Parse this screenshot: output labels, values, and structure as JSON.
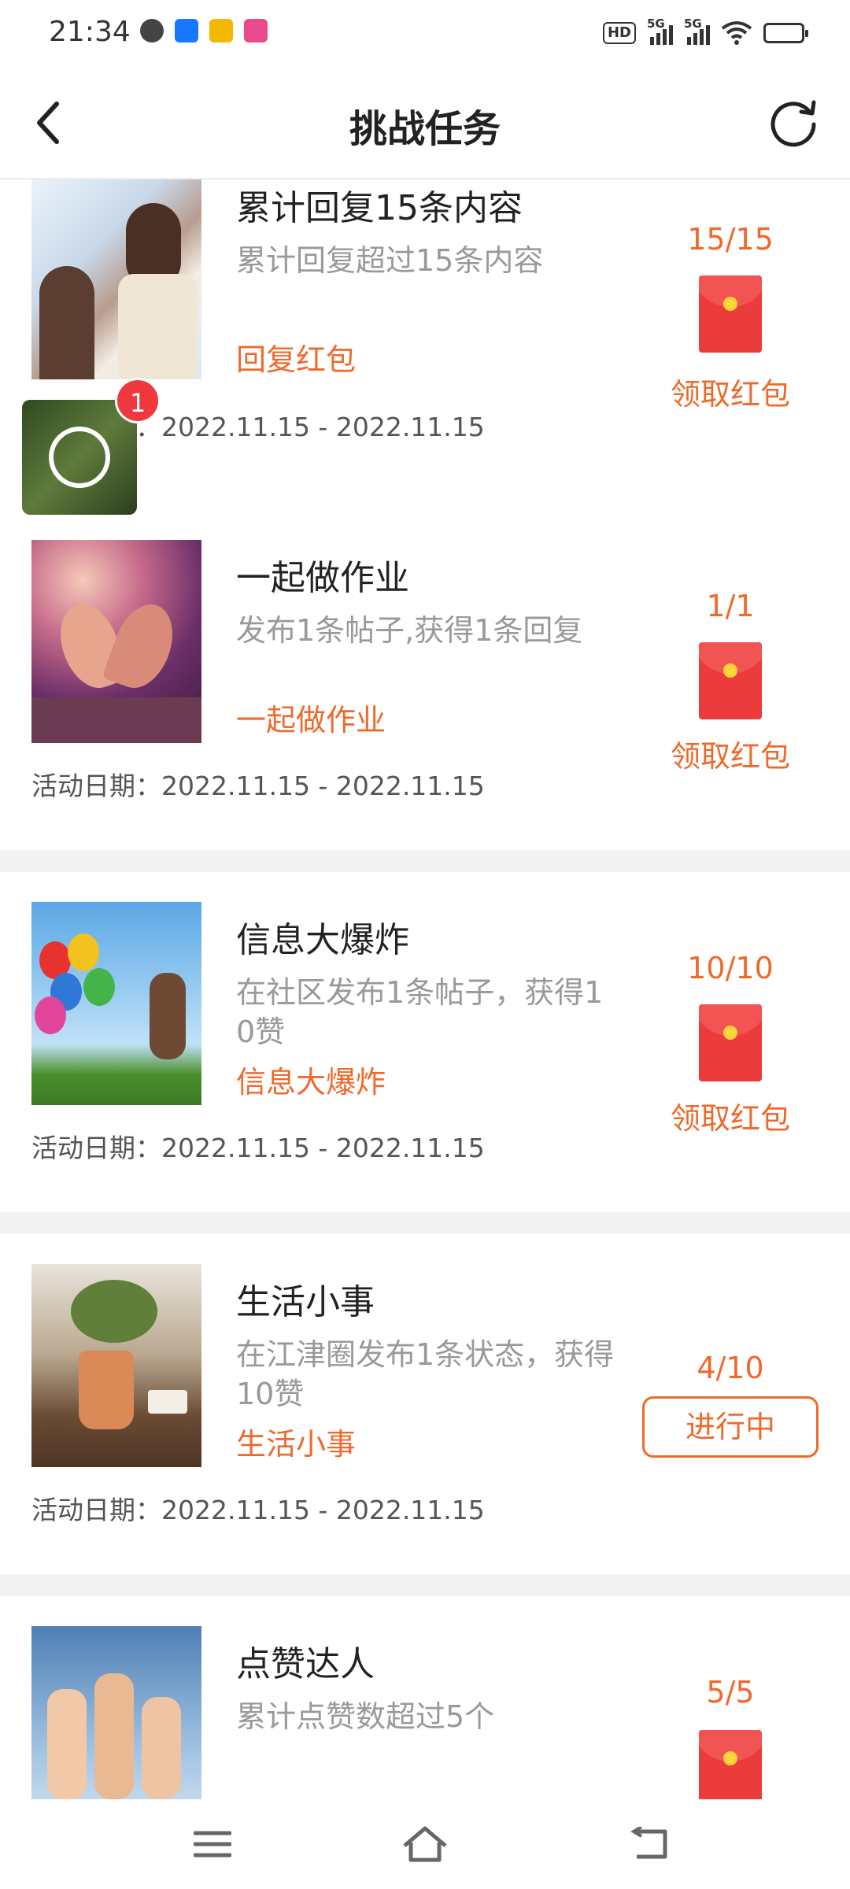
{
  "status_bar": {
    "time": "21:34",
    "indicators": [
      "HD",
      "5G",
      "5G",
      "wifi-icon",
      "battery-icon"
    ]
  },
  "nav": {
    "title": "挑战任务",
    "back_icon": "chevron-left-icon",
    "refresh_icon": "refresh-icon"
  },
  "tasks": [
    {
      "title": "累计回复15条内容",
      "desc": "累计回复超过15条内容",
      "tag": "回复红包",
      "date": "活动日期：2022.11.15 - 2022.11.15",
      "progress": "15/15",
      "action": "领取红包"
    },
    {
      "title": "一起做作业",
      "desc": "发布1条帖子,获得1条回复",
      "tag": "一起做作业",
      "date": "活动日期：2022.11.15 - 2022.11.15",
      "progress": "1/1",
      "action": "领取红包"
    },
    {
      "title": "信息大爆炸",
      "desc": "在社区发布1条帖子，获得10赞",
      "tag": "信息大爆炸",
      "date": "活动日期：2022.11.15 - 2022.11.15",
      "progress": "10/10",
      "action": "领取红包"
    },
    {
      "title": "生活小事",
      "desc": "在江津圈发布1条状态，获得10赞",
      "tag": "生活小事",
      "date": "活动日期：2022.11.15 - 2022.11.15",
      "progress": "4/10",
      "action": "进行中"
    },
    {
      "title": "点赞达人",
      "desc": "累计点赞数超过5个",
      "progress": "5/5"
    }
  ],
  "float_widget": {
    "badge": "1"
  },
  "colors": {
    "accent": "#ee6a2c",
    "envelope": "#ec3b3b",
    "badge": "#f0383f"
  },
  "system_nav": [
    "menu-icon",
    "home-icon",
    "back-icon"
  ]
}
